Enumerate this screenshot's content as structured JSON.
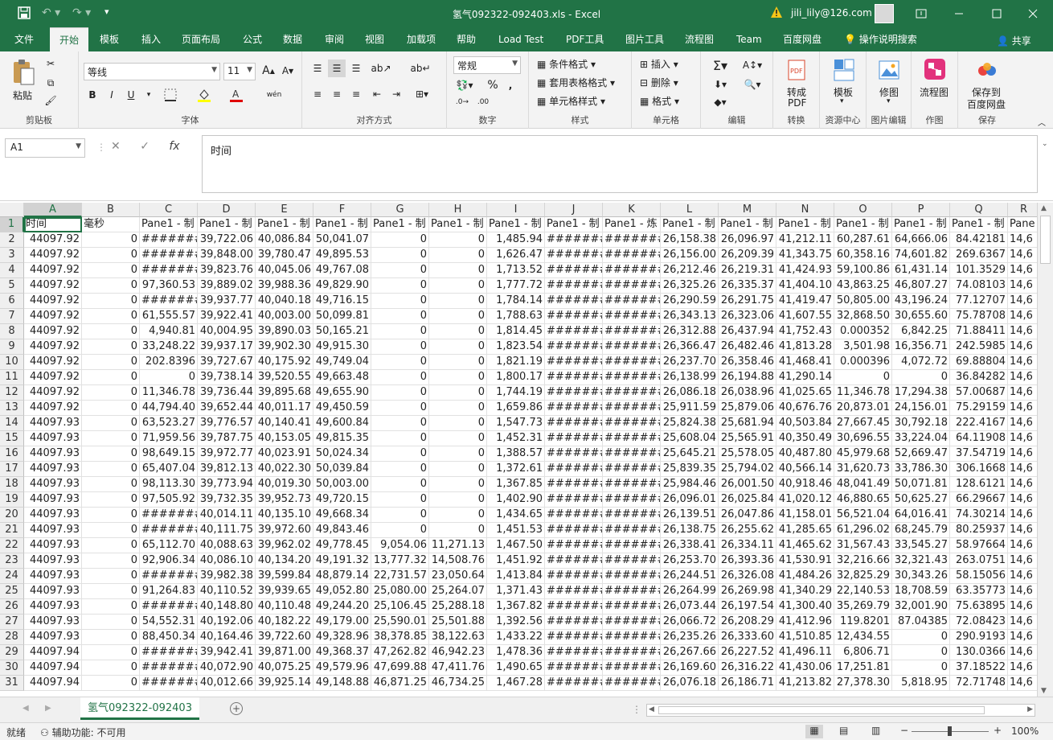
{
  "app": {
    "window_title": "氢气092322-092403.xls  -  Excel",
    "user": "jili_lily@126.com",
    "accent": "#217346"
  },
  "menu_tabs": [
    "文件",
    "开始",
    "模板",
    "插入",
    "页面布局",
    "公式",
    "数据",
    "审阅",
    "视图",
    "加载项",
    "帮助",
    "Load Test",
    "PDF工具",
    "图片工具",
    "流程图",
    "Team",
    "百度网盘",
    "操作说明搜索"
  ],
  "share_label": "共享",
  "ribbon": {
    "clipboard": {
      "paste": "粘贴",
      "label": "剪贴板"
    },
    "font": {
      "name": "等线",
      "size": "11",
      "label": "字体",
      "bold": "B",
      "italic": "I",
      "underline": "U",
      "phonetic": "wén"
    },
    "alignment": {
      "label": "对齐方式"
    },
    "number": {
      "format": "常规",
      "label": "数字",
      "percent": "%"
    },
    "styles": {
      "cond": "条件格式",
      "table": "套用表格格式",
      "cell": "单元格样式",
      "label": "样式"
    },
    "cells": {
      "insert": "插入",
      "delete": "删除",
      "format": "格式",
      "label": "单元格"
    },
    "editing": {
      "label": "编辑"
    },
    "convert": {
      "btn1": "转成",
      "btn2": "PDF",
      "label": "转换"
    },
    "resource": {
      "btn": "模板",
      "label": "资源中心"
    },
    "image": {
      "btn": "修图",
      "label": "图片编辑"
    },
    "drawing": {
      "btn": "流程图",
      "label": "作图"
    },
    "save": {
      "btn1": "保存到",
      "btn2": "百度网盘",
      "label": "保存"
    }
  },
  "formula_bar": {
    "name_box": "A1",
    "content": "时间"
  },
  "columns": [
    "A",
    "B",
    "C",
    "D",
    "E",
    "F",
    "G",
    "H",
    "I",
    "J",
    "K",
    "L",
    "M",
    "N",
    "O",
    "P",
    "Q",
    "R"
  ],
  "header_row": [
    "时间",
    "毫秒",
    "Pane1 - 制",
    "Pane1 - 制",
    "Pane1 - 制",
    "Pane1 - 制",
    "Pane1 - 制",
    "Pane1 - 制",
    "Pane1 - 制",
    "Pane1 - 制",
    "Pane1 - 炼",
    "Pane1 - 制",
    "Pane1 - 制",
    "Pane1 - 制",
    "Pane1 - 制",
    "Pane1 - 制",
    "Pane1 - 制",
    "Pane"
  ],
  "rows": [
    [
      "44097.92",
      "0",
      "#######",
      "39,722.06",
      "40,086.84",
      "50,041.07",
      "0",
      "0",
      "1,485.94",
      "#######",
      "#######",
      "26,158.38",
      "26,096.97",
      "41,212.11",
      "60,287.61",
      "64,666.06",
      "84.42181",
      "14,6"
    ],
    [
      "44097.92",
      "0",
      "#######",
      "39,848.00",
      "39,780.47",
      "49,895.53",
      "0",
      "0",
      "1,626.47",
      "#######",
      "#######",
      "26,156.00",
      "26,209.39",
      "41,343.75",
      "60,358.16",
      "74,601.82",
      "269.6367",
      "14,6"
    ],
    [
      "44097.92",
      "0",
      "#######",
      "39,823.76",
      "40,045.06",
      "49,767.08",
      "0",
      "0",
      "1,713.52",
      "#######",
      "#######",
      "26,212.46",
      "26,219.31",
      "41,424.93",
      "59,100.86",
      "61,431.14",
      "101.3529",
      "14,6"
    ],
    [
      "44097.92",
      "0",
      "97,360.53",
      "39,889.02",
      "39,988.36",
      "49,829.90",
      "0",
      "0",
      "1,777.72",
      "#######",
      "#######",
      "26,325.26",
      "26,335.37",
      "41,404.10",
      "43,863.25",
      "46,807.27",
      "74.08103",
      "14,6"
    ],
    [
      "44097.92",
      "0",
      "#######",
      "39,937.77",
      "40,040.18",
      "49,716.15",
      "0",
      "0",
      "1,784.14",
      "#######",
      "#######",
      "26,290.59",
      "26,291.75",
      "41,419.47",
      "50,805.00",
      "43,196.24",
      "77.12707",
      "14,6"
    ],
    [
      "44097.92",
      "0",
      "61,555.57",
      "39,922.41",
      "40,003.00",
      "50,099.81",
      "0",
      "0",
      "1,788.63",
      "#######",
      "#######",
      "26,343.13",
      "26,323.06",
      "41,607.55",
      "32,868.50",
      "30,655.60",
      "75.78708",
      "14,6"
    ],
    [
      "44097.92",
      "0",
      "4,940.81",
      "40,004.95",
      "39,890.03",
      "50,165.21",
      "0",
      "0",
      "1,814.45",
      "#######",
      "#######",
      "26,312.88",
      "26,437.94",
      "41,752.43",
      "0.000352",
      "6,842.25",
      "71.88411",
      "14,6"
    ],
    [
      "44097.92",
      "0",
      "33,248.22",
      "39,937.17",
      "39,902.30",
      "49,915.30",
      "0",
      "0",
      "1,823.54",
      "#######",
      "#######",
      "26,366.47",
      "26,482.46",
      "41,813.28",
      "3,501.98",
      "16,356.71",
      "242.5985",
      "14,6"
    ],
    [
      "44097.92",
      "0",
      "202.8396",
      "39,727.67",
      "40,175.92",
      "49,749.04",
      "0",
      "0",
      "1,821.19",
      "#######",
      "#######",
      "26,237.70",
      "26,358.46",
      "41,468.41",
      "0.000396",
      "4,072.72",
      "69.88804",
      "14,6"
    ],
    [
      "44097.92",
      "0",
      "0",
      "39,738.14",
      "39,520.55",
      "49,663.48",
      "0",
      "0",
      "1,800.17",
      "#######",
      "#######",
      "26,138.99",
      "26,194.88",
      "41,290.14",
      "0",
      "0",
      "36.84282",
      "14,6"
    ],
    [
      "44097.92",
      "0",
      "11,346.78",
      "39,736.44",
      "39,895.68",
      "49,655.90",
      "0",
      "0",
      "1,744.19",
      "#######",
      "#######",
      "26,086.18",
      "26,038.96",
      "41,025.65",
      "11,346.78",
      "17,294.38",
      "57.00687",
      "14,6"
    ],
    [
      "44097.92",
      "0",
      "44,794.40",
      "39,652.44",
      "40,011.17",
      "49,450.59",
      "0",
      "0",
      "1,659.86",
      "#######",
      "#######",
      "25,911.59",
      "25,879.06",
      "40,676.76",
      "20,873.01",
      "24,156.01",
      "75.29159",
      "14,6"
    ],
    [
      "44097.93",
      "0",
      "63,523.27",
      "39,776.57",
      "40,140.41",
      "49,600.84",
      "0",
      "0",
      "1,547.73",
      "#######",
      "#######",
      "25,824.38",
      "25,681.94",
      "40,503.84",
      "27,667.45",
      "30,792.18",
      "222.4167",
      "14,6"
    ],
    [
      "44097.93",
      "0",
      "71,959.56",
      "39,787.75",
      "40,153.05",
      "49,815.35",
      "0",
      "0",
      "1,452.31",
      "#######",
      "#######",
      "25,608.04",
      "25,565.91",
      "40,350.49",
      "30,696.55",
      "33,224.04",
      "64.11908",
      "14,6"
    ],
    [
      "44097.93",
      "0",
      "98,649.15",
      "39,972.77",
      "40,023.91",
      "50,024.34",
      "0",
      "0",
      "1,388.57",
      "#######",
      "#######",
      "25,645.21",
      "25,578.05",
      "40,487.80",
      "45,979.68",
      "52,669.47",
      "37.54719",
      "14,6"
    ],
    [
      "44097.93",
      "0",
      "65,407.04",
      "39,812.13",
      "40,022.30",
      "50,039.84",
      "0",
      "0",
      "1,372.61",
      "#######",
      "#######",
      "25,839.35",
      "25,794.02",
      "40,566.14",
      "31,620.73",
      "33,786.30",
      "306.1668",
      "14,6"
    ],
    [
      "44097.93",
      "0",
      "98,113.30",
      "39,773.94",
      "40,019.30",
      "50,003.00",
      "0",
      "0",
      "1,367.85",
      "#######",
      "#######",
      "25,984.46",
      "26,001.50",
      "40,918.46",
      "48,041.49",
      "50,071.81",
      "128.6121",
      "14,6"
    ],
    [
      "44097.93",
      "0",
      "97,505.92",
      "39,732.35",
      "39,952.73",
      "49,720.15",
      "0",
      "0",
      "1,402.90",
      "#######",
      "#######",
      "26,096.01",
      "26,025.84",
      "41,020.12",
      "46,880.65",
      "50,625.27",
      "66.29667",
      "14,6"
    ],
    [
      "44097.93",
      "0",
      "#######",
      "40,014.11",
      "40,135.10",
      "49,668.34",
      "0",
      "0",
      "1,434.65",
      "#######",
      "#######",
      "26,139.51",
      "26,047.86",
      "41,158.01",
      "56,521.04",
      "64,016.41",
      "74.30214",
      "14,6"
    ],
    [
      "44097.93",
      "0",
      "#######",
      "40,111.75",
      "39,972.60",
      "49,843.46",
      "0",
      "0",
      "1,451.53",
      "#######",
      "#######",
      "26,138.75",
      "26,255.62",
      "41,285.65",
      "61,296.02",
      "68,245.79",
      "80.25937",
      "14,6"
    ],
    [
      "44097.93",
      "0",
      "65,112.70",
      "40,088.63",
      "39,962.02",
      "49,778.45",
      "9,054.06",
      "11,271.13",
      "1,467.50",
      "#######",
      "#######",
      "26,338.41",
      "26,334.11",
      "41,465.62",
      "31,567.43",
      "33,545.27",
      "58.97664",
      "14,6"
    ],
    [
      "44097.93",
      "0",
      "92,906.34",
      "40,086.10",
      "40,134.20",
      "49,191.32",
      "13,777.32",
      "14,508.76",
      "1,451.92",
      "#######",
      "#######",
      "26,253.70",
      "26,393.36",
      "41,530.91",
      "32,216.66",
      "32,321.43",
      "263.0751",
      "14,6"
    ],
    [
      "44097.93",
      "0",
      "#######",
      "39,982.38",
      "39,599.84",
      "48,879.14",
      "22,731.57",
      "23,050.64",
      "1,413.84",
      "#######",
      "#######",
      "26,244.51",
      "26,326.08",
      "41,484.26",
      "32,825.29",
      "30,343.26",
      "58.15056",
      "14,6"
    ],
    [
      "44097.93",
      "0",
      "91,264.83",
      "40,110.52",
      "39,939.65",
      "49,052.80",
      "25,080.00",
      "25,264.07",
      "1,371.43",
      "#######",
      "#######",
      "26,264.99",
      "26,269.98",
      "41,340.29",
      "22,140.53",
      "18,708.59",
      "63.35773",
      "14,6"
    ],
    [
      "44097.93",
      "0",
      "#######",
      "40,148.80",
      "40,110.48",
      "49,244.20",
      "25,106.45",
      "25,288.18",
      "1,367.82",
      "#######",
      "#######",
      "26,073.44",
      "26,197.54",
      "41,300.40",
      "35,269.79",
      "32,001.90",
      "75.63895",
      "14,6"
    ],
    [
      "44097.93",
      "0",
      "54,552.31",
      "40,192.06",
      "40,182.22",
      "49,179.00",
      "25,590.01",
      "25,501.88",
      "1,392.56",
      "#######",
      "#######",
      "26,066.72",
      "26,208.29",
      "41,412.96",
      "119.8201",
      "87.04385",
      "72.08423",
      "14,6"
    ],
    [
      "44097.93",
      "0",
      "88,450.34",
      "40,164.46",
      "39,722.60",
      "49,328.96",
      "38,378.85",
      "38,122.63",
      "1,433.22",
      "#######",
      "#######",
      "26,235.26",
      "26,333.60",
      "41,510.85",
      "12,434.55",
      "0",
      "290.9193",
      "14,6"
    ],
    [
      "44097.94",
      "0",
      "#######",
      "39,942.41",
      "39,871.00",
      "49,368.37",
      "47,262.82",
      "46,942.23",
      "1,478.36",
      "#######",
      "#######",
      "26,267.66",
      "26,227.52",
      "41,496.11",
      "6,806.71",
      "0",
      "130.0366",
      "14,6"
    ],
    [
      "44097.94",
      "0",
      "#######",
      "40,072.90",
      "40,075.25",
      "49,579.96",
      "47,699.88",
      "47,411.76",
      "1,490.65",
      "#######",
      "#######",
      "26,169.60",
      "26,316.22",
      "41,430.06",
      "17,251.81",
      "0",
      "37.18522",
      "14,6"
    ],
    [
      "44097.94",
      "0",
      "#######",
      "40,012.66",
      "39,925.14",
      "49,148.88",
      "46,871.25",
      "46,734.25",
      "1,467.28",
      "#######",
      "#######",
      "26,076.18",
      "26,186.71",
      "41,213.82",
      "27,378.30",
      "5,818.95",
      "72.71748",
      "14,6"
    ]
  ],
  "sheet_tab": "氢气092322-092403",
  "status": {
    "ready": "就绪",
    "accessibility": "辅助功能: 不可用",
    "zoom": "100%"
  }
}
